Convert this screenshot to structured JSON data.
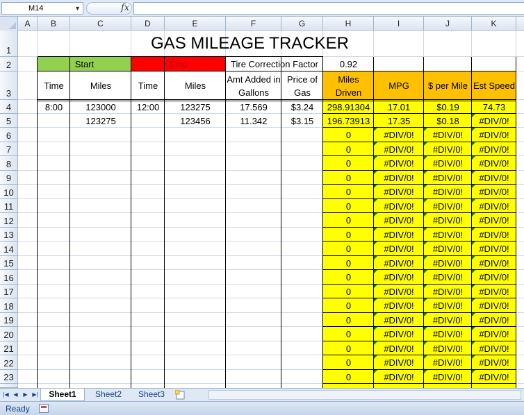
{
  "formula_bar": {
    "name_box": "M14",
    "name_box_arrow": "▼",
    "fx_label": "fx",
    "formula": ""
  },
  "columns": [
    "A",
    "B",
    "C",
    "D",
    "E",
    "F",
    "G",
    "H",
    "I",
    "J",
    "K"
  ],
  "rows": [
    "1",
    "2",
    "3",
    "4",
    "5",
    "6",
    "7",
    "8",
    "9",
    "10",
    "11",
    "12",
    "13",
    "14",
    "15",
    "16",
    "17",
    "18",
    "19",
    "20",
    "21",
    "22",
    "23"
  ],
  "sheet": {
    "title": "GAS MILEAGE TRACKER",
    "start_label": "Start",
    "stop_label": "Stop",
    "tire_label": "Tire Correction Factor",
    "tire_value": "0.92",
    "headers": {
      "b": "Time",
      "c": "Miles",
      "d": "Time",
      "e": "Miles",
      "f": "Amt Added in Gallons",
      "g": "Price of Gas",
      "h": "Miles Driven",
      "i": "MPG",
      "j": "$ per Mile",
      "k": "Est Speed"
    },
    "data_rows": [
      {
        "b": "8:00",
        "c": "123000",
        "d": "12:00",
        "e": "123275",
        "f": "17.569",
        "g": "$3.24",
        "h": "298.91304",
        "i": "17.01",
        "j": "$0.19",
        "k": "74.73"
      },
      {
        "b": "",
        "c": "123275",
        "d": "",
        "e": "123456",
        "f": "11.342",
        "g": "$3.15",
        "h": "196.73913",
        "i": "17.35",
        "j": "$0.18",
        "k": "#DIV/0!"
      }
    ],
    "empty_row_values": {
      "h": "0",
      "i": "#DIV/0!",
      "j": "#DIV/0!",
      "k": "#DIV/0!"
    }
  },
  "tabs": {
    "nav": [
      "|◀",
      "◀",
      "▶",
      "▶|"
    ],
    "sheets": [
      "Sheet1",
      "Sheet2",
      "Sheet3"
    ],
    "active": "Sheet1"
  },
  "status": {
    "text": "Ready"
  },
  "colors": {
    "yellow": "#ffff00",
    "orange": "#ffc000",
    "green": "#92d050",
    "red": "#ff0000",
    "error_marker": "#008000"
  }
}
